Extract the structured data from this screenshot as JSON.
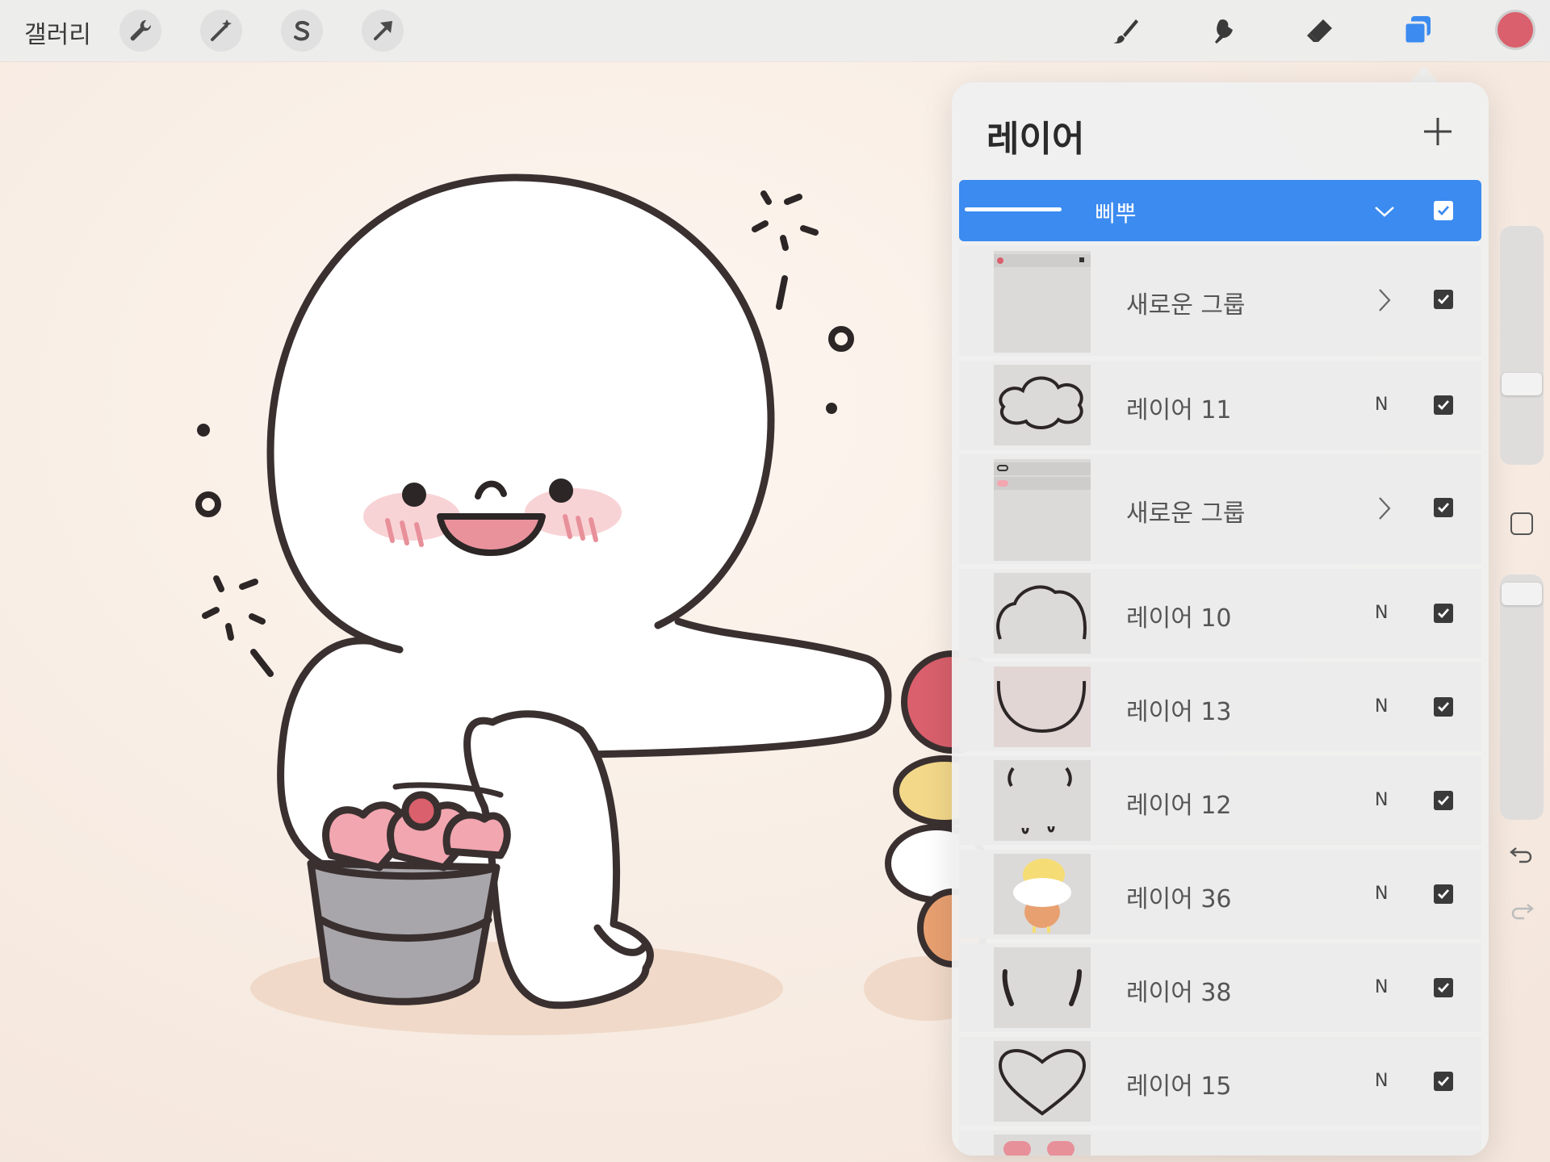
{
  "topbar": {
    "gallery_label": "갤러리",
    "left_tools": [
      "wrench-icon",
      "magic-wand-icon",
      "selection-s-icon",
      "transform-arrow-icon"
    ],
    "right_tools": [
      "brush-icon",
      "smudge-icon",
      "eraser-icon",
      "layers-icon"
    ],
    "active_tool": "layers-icon",
    "color_swatch": "#d9606c"
  },
  "layers_panel": {
    "title": "레이어",
    "layers": [
      {
        "name": "삐뿌",
        "kind": "group",
        "active": true,
        "expanded": true,
        "visible": true
      },
      {
        "name": "새로운 그룹",
        "kind": "group",
        "active": false,
        "visible": true
      },
      {
        "name": "레이어 11",
        "kind": "layer",
        "blend": "N",
        "visible": true
      },
      {
        "name": "새로운 그룹",
        "kind": "group",
        "active": false,
        "visible": true
      },
      {
        "name": "레이어 10",
        "kind": "layer",
        "blend": "N",
        "visible": true
      },
      {
        "name": "레이어 13",
        "kind": "layer",
        "blend": "N",
        "visible": true
      },
      {
        "name": "레이어 12",
        "kind": "layer",
        "blend": "N",
        "visible": true
      },
      {
        "name": "레이어 36",
        "kind": "layer",
        "blend": "N",
        "visible": true
      },
      {
        "name": "레이어 38",
        "kind": "layer",
        "blend": "N",
        "visible": true
      },
      {
        "name": "레이어 15",
        "kind": "layer",
        "blend": "N",
        "visible": true
      }
    ]
  },
  "colors": {
    "accent": "#3b8bf0",
    "canvas_bg": "#f7ece4",
    "outline": "#3a3030",
    "blush": "#f2a9b0"
  }
}
